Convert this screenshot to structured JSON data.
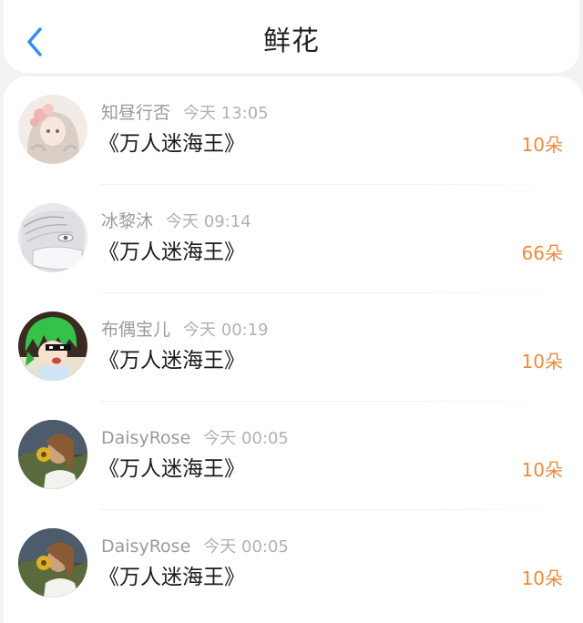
{
  "header": {
    "title": "鲜花",
    "back_icon": "chevron-left-icon",
    "accent_color": "#2f8ef7"
  },
  "records": [
    {
      "user": "知昼行否",
      "time": "今天 13:05",
      "book": "《万人迷海王》",
      "count": "10朵",
      "avatar": "anime-girl-flowers-avatar"
    },
    {
      "user": "冰黎沐",
      "time": "今天 09:14",
      "book": "《万人迷海王》",
      "count": "66朵",
      "avatar": "sketch-girl-mask-avatar"
    },
    {
      "user": "布偶宝儿",
      "time": "今天 00:19",
      "book": "《万人迷海王》",
      "count": "10朵",
      "avatar": "green-hair-sunglasses-avatar"
    },
    {
      "user": "DaisyRose",
      "time": "今天 00:05",
      "book": "《万人迷海王》",
      "count": "10朵",
      "avatar": "girl-sunflower-photo-avatar"
    },
    {
      "user": "DaisyRose",
      "time": "今天 00:05",
      "book": "《万人迷海王》",
      "count": "10朵",
      "avatar": "girl-sunflower-photo-avatar"
    }
  ],
  "colors": {
    "count": "#f08a3a",
    "name": "#9a9a9a",
    "time": "#b1b1b1",
    "background": "#f2f3f5"
  }
}
